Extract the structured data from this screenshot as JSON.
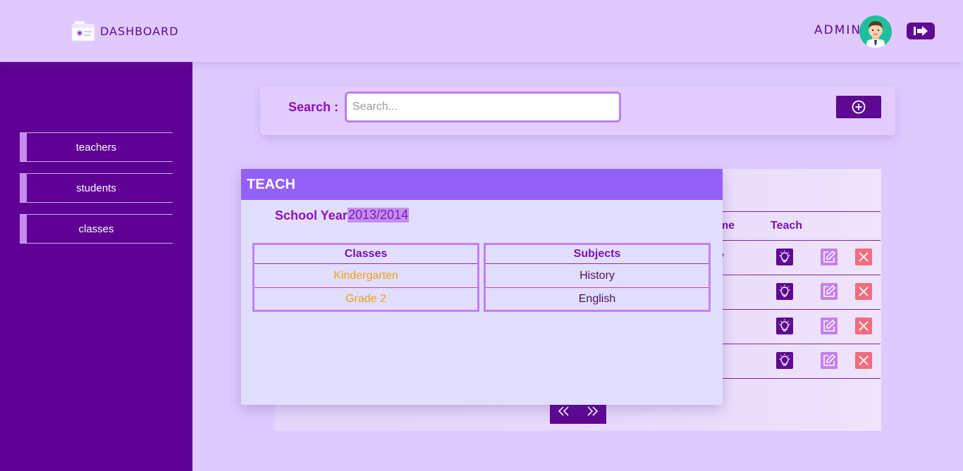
{
  "header": {
    "brand": "DASHBOARD",
    "user": "ADMIN"
  },
  "sidebar": {
    "items": [
      {
        "label": "teachers"
      },
      {
        "label": "students"
      },
      {
        "label": "classes"
      }
    ]
  },
  "search": {
    "label": "Search :",
    "placeholder": "Search..."
  },
  "table": {
    "columns": [
      "me",
      "Teach"
    ],
    "visible_cell_fragments": [
      "y"
    ]
  },
  "modal": {
    "title": "TEACH",
    "year_label": "School Year :",
    "year_value": "2013/2014",
    "classes_header": "Classes",
    "subjects_header": "Subjects",
    "classes": [
      "Kindergarten",
      "Grade 2"
    ],
    "subjects": [
      "History",
      "English"
    ]
  },
  "colors": {
    "brand_purple": "#5e0093",
    "accent_violet": "#9360f8",
    "class_orange": "#f0a018",
    "delete_red": "#f26d7d"
  },
  "icons": [
    "logo-icon",
    "avatar-icon",
    "logout-icon",
    "add-circle-icon",
    "lightbulb-icon",
    "edit-icon",
    "close-icon",
    "chevrons-left-icon",
    "chevrons-right-icon"
  ]
}
